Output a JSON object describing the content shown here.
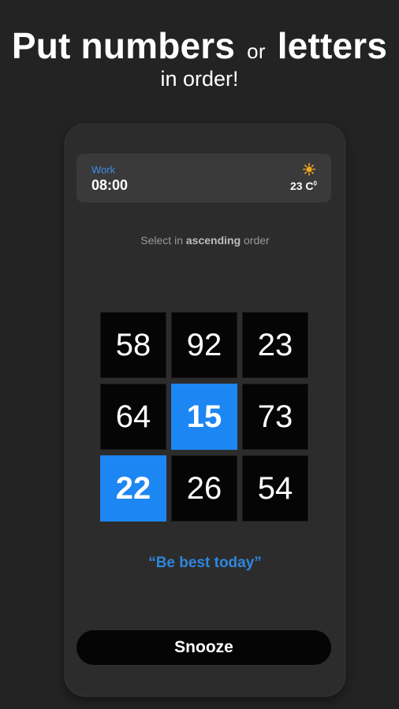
{
  "header": {
    "title_part1": "Put numbers",
    "title_connector": "or",
    "title_part2": "letters",
    "subtitle": "in order!"
  },
  "alarm": {
    "label": "Work",
    "time": "08:00",
    "weather_icon": "sun-icon",
    "temperature": "23 C",
    "temperature_unit_mark": "0"
  },
  "instruction": {
    "prefix": "Select in",
    "emphasis": "ascending",
    "suffix": "order"
  },
  "grid": {
    "tiles": [
      {
        "value": "58",
        "selected": false
      },
      {
        "value": "92",
        "selected": false
      },
      {
        "value": "23",
        "selected": false
      },
      {
        "value": "64",
        "selected": false
      },
      {
        "value": "15",
        "selected": true
      },
      {
        "value": "73",
        "selected": false
      },
      {
        "value": "22",
        "selected": true
      },
      {
        "value": "26",
        "selected": false
      },
      {
        "value": "54",
        "selected": false
      }
    ]
  },
  "quote": "“Be best today”",
  "snooze_label": "Snooze",
  "colors": {
    "accent": "#1c86f2",
    "background": "#232323",
    "card": "#3a3a3a",
    "sun": "#f5a623"
  }
}
